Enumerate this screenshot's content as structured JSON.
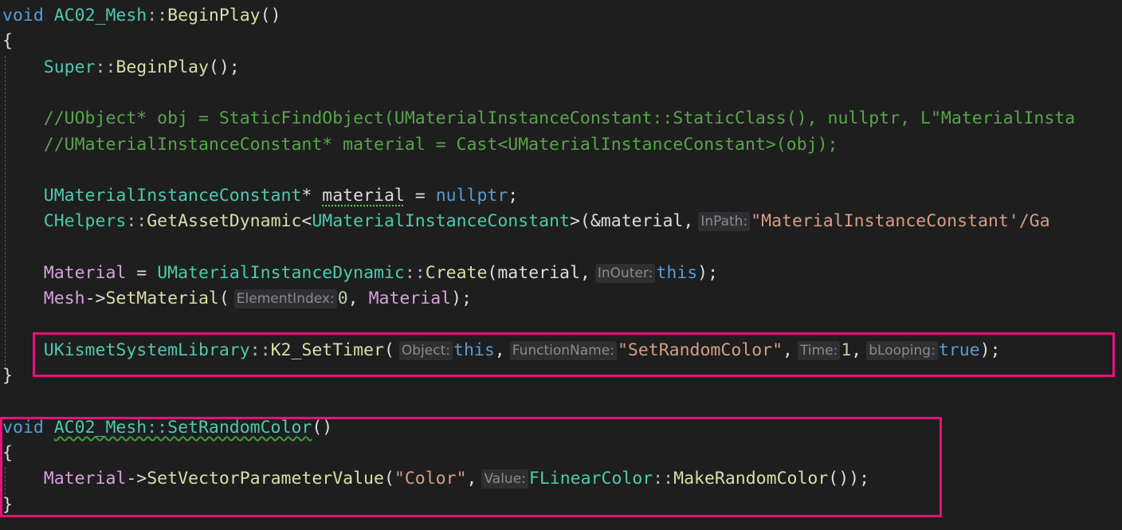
{
  "lines": [
    {
      "tokens": [
        [
          "void",
          "kw"
        ],
        [
          " ",
          "plain"
        ],
        [
          "AC02_Mesh",
          "type"
        ],
        [
          "::",
          "op"
        ],
        [
          "BeginPlay",
          "fn"
        ],
        [
          "()",
          "plain"
        ]
      ]
    },
    {
      "tokens": [
        [
          "{",
          "plain"
        ]
      ]
    },
    {
      "tokens": [
        [
          "    ",
          "plain"
        ],
        [
          "Super",
          "type"
        ],
        [
          "::",
          "op"
        ],
        [
          "BeginPlay",
          "fn"
        ],
        [
          "();",
          "plain"
        ]
      ]
    },
    {
      "tokens": []
    },
    {
      "tokens": [
        [
          "    ",
          "plain"
        ],
        [
          "//UObject* obj = StaticFindObject(UMaterialInstanceConstant::StaticClass(), nullptr, L\"MaterialInsta",
          "comment"
        ]
      ]
    },
    {
      "tokens": [
        [
          "    ",
          "plain"
        ],
        [
          "//UMaterialInstanceConstant* material = Cast<UMaterialInstanceConstant>(obj);",
          "comment"
        ]
      ]
    },
    {
      "tokens": []
    },
    {
      "tokens": [
        [
          "    ",
          "plain"
        ],
        [
          "UMaterialInstanceConstant",
          "type"
        ],
        [
          "* ",
          "plain"
        ],
        [
          "material",
          "dash"
        ],
        [
          " = ",
          "plain"
        ],
        [
          "nullptr",
          "kw"
        ],
        [
          ";",
          "plain"
        ]
      ]
    },
    {
      "tokens": [
        [
          "    ",
          "plain"
        ],
        [
          "CHelpers",
          "type"
        ],
        [
          "::",
          "op"
        ],
        [
          "GetAssetDynamic",
          "fn"
        ],
        [
          "<",
          "plain"
        ],
        [
          "UMaterialInstanceConstant",
          "type"
        ],
        [
          ">(&material,",
          "plain"
        ],
        [
          "InPath:",
          "hint"
        ],
        [
          "\"MaterialInstanceConstant'/Ga",
          "str"
        ]
      ]
    },
    {
      "tokens": []
    },
    {
      "tokens": [
        [
          "    ",
          "plain"
        ],
        [
          "Material",
          "macro"
        ],
        [
          " = ",
          "plain"
        ],
        [
          "UMaterialInstanceDynamic",
          "type"
        ],
        [
          "::",
          "op"
        ],
        [
          "Create",
          "fn"
        ],
        [
          "(material,",
          "plain"
        ],
        [
          "InOuter:",
          "hint"
        ],
        [
          "this",
          "kw"
        ],
        [
          ");",
          "plain"
        ]
      ]
    },
    {
      "tokens": [
        [
          "    ",
          "plain"
        ],
        [
          "Mesh",
          "macro"
        ],
        [
          "->",
          "plain"
        ],
        [
          "SetMaterial",
          "fn"
        ],
        [
          "(",
          "plain"
        ],
        [
          "ElementIndex:",
          "hint"
        ],
        [
          "0",
          "num"
        ],
        [
          ", ",
          "plain"
        ],
        [
          "Material",
          "macro"
        ],
        [
          ");",
          "plain"
        ]
      ]
    },
    {
      "tokens": []
    },
    {
      "tokens": [
        [
          "    ",
          "plain"
        ],
        [
          "UKismetSystemLibrary",
          "type"
        ],
        [
          "::",
          "op"
        ],
        [
          "K2_SetTimer",
          "fn"
        ],
        [
          "(",
          "plain"
        ],
        [
          "Object:",
          "hint"
        ],
        [
          "this",
          "kw"
        ],
        [
          ",",
          "plain"
        ],
        [
          "FunctionName:",
          "hint"
        ],
        [
          "\"SetRandomColor\"",
          "str"
        ],
        [
          ",",
          "plain"
        ],
        [
          "Time:",
          "hint"
        ],
        [
          "1",
          "num"
        ],
        [
          ",",
          "plain"
        ],
        [
          "bLooping:",
          "hint"
        ],
        [
          "true",
          "kw"
        ],
        [
          ");",
          "plain"
        ]
      ]
    },
    {
      "tokens": [
        [
          "}",
          "plain"
        ]
      ]
    },
    {
      "tokens": []
    },
    {
      "tokens": [
        [
          "void",
          "kw"
        ],
        [
          " ",
          "plain"
        ],
        [
          "AC02_Mesh::SetRandomColor",
          "squig-type"
        ],
        [
          "()",
          "plain"
        ]
      ]
    },
    {
      "tokens": [
        [
          "{",
          "plain"
        ]
      ]
    },
    {
      "tokens": [
        [
          "    ",
          "plain"
        ],
        [
          "Material",
          "macro"
        ],
        [
          "->",
          "plain"
        ],
        [
          "SetVectorParameterValue",
          "fn"
        ],
        [
          "(",
          "plain"
        ],
        [
          "\"Color\"",
          "str"
        ],
        [
          ",",
          "plain"
        ],
        [
          "Value:",
          "hint"
        ],
        [
          "FLinearColor",
          "type"
        ],
        [
          "::",
          "op"
        ],
        [
          "MakeRandomColor",
          "fn"
        ],
        [
          "());",
          "plain"
        ]
      ]
    },
    {
      "tokens": [
        [
          "}",
          "plain"
        ]
      ]
    }
  ]
}
